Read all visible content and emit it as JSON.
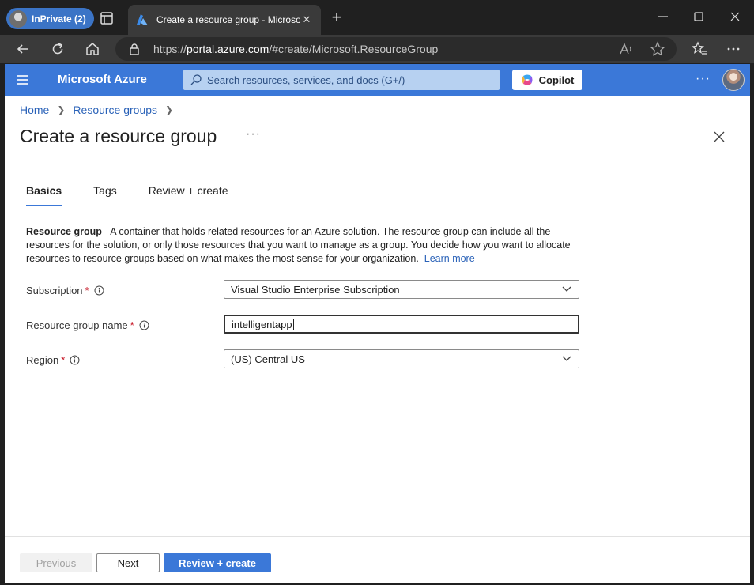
{
  "browser": {
    "profile_label": "InPrivate (2)",
    "tab_title": "Create a resource group - Microsoft Azure",
    "url_prefix": "https://",
    "url_host": "portal.azure.com",
    "url_path": "/#create/Microsoft.ResourceGroup"
  },
  "azure_header": {
    "brand": "Microsoft Azure",
    "search_placeholder": "Search resources, services, and docs (G+/)",
    "copilot_label": "Copilot",
    "more": "···"
  },
  "breadcrumb": {
    "items": [
      "Home",
      "Resource groups"
    ]
  },
  "page": {
    "title": "Create a resource group",
    "more": "···"
  },
  "tabs": [
    {
      "label": "Basics",
      "active": true
    },
    {
      "label": "Tags",
      "active": false
    },
    {
      "label": "Review + create",
      "active": false
    }
  ],
  "description": {
    "bold": "Resource group",
    "text": " - A container that holds related resources for an Azure solution. The resource group can include all the resources for the solution, or only those resources that you want to manage as a group. You decide how you want to allocate resources to resource groups based on what makes the most sense for your organization.",
    "link": "Learn more"
  },
  "form": {
    "subscription": {
      "label": "Subscription",
      "required": "*",
      "value": "Visual Studio Enterprise Subscription"
    },
    "rg_name": {
      "label": "Resource group name",
      "required": "*",
      "value": "intelligentapp"
    },
    "region": {
      "label": "Region",
      "required": "*",
      "value": "(US) Central US"
    }
  },
  "footer": {
    "previous": "Previous",
    "next": "Next",
    "review": "Review + create"
  },
  "colors": {
    "azure_blue": "#3b78d8",
    "link_blue": "#2a62b8"
  }
}
